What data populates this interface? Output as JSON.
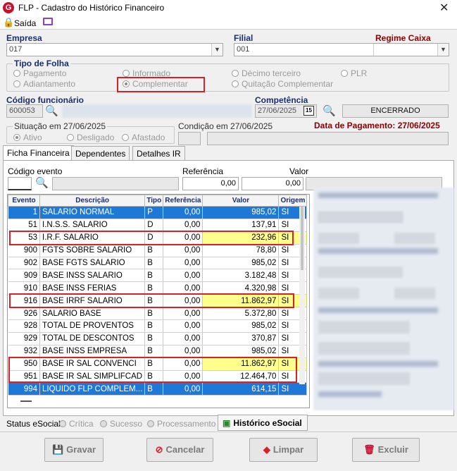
{
  "window": {
    "title": "FLP - Cadastro do Histórico Financeiro",
    "app_letter": "G"
  },
  "menu": {
    "exit_label": "Saída"
  },
  "empresa": {
    "label": "Empresa",
    "value": "017"
  },
  "filial": {
    "label": "Filial",
    "value": "001"
  },
  "regime": {
    "label": "Regime Caixa"
  },
  "tipo_folha": {
    "title": "Tipo de Folha",
    "options": [
      "Pagamento",
      "Informado",
      "Décimo terceiro",
      "PLR",
      "Adiantamento",
      "Complementar",
      "Quitação Complementar"
    ],
    "selected": "Complementar"
  },
  "codigo_funcionario": {
    "label": "Código funcionário",
    "value": "600053"
  },
  "competencia": {
    "label": "Competência",
    "value": "27/06/2025",
    "calendar_icon": "15",
    "status": "ENCERRADO"
  },
  "situacao": {
    "title": "Situação em 27/06/2025",
    "options": [
      "Ativo",
      "Desligado",
      "Afastado"
    ],
    "selected": "Ativo"
  },
  "condicao": {
    "title": "Condição em 27/06/2025"
  },
  "data_pagamento": "Data de Pagamento: 27/06/2025",
  "tabs": [
    "Ficha Financeira",
    "Dependentes",
    "Detalhes IR"
  ],
  "evento_form": {
    "codigo_label": "Código evento",
    "referencia_label": "Referência",
    "valor_label": "Valor",
    "referencia": "0,00",
    "valor": "0,00"
  },
  "grid": {
    "headers": [
      "Evento",
      "Descrição",
      "Tipo",
      "Referência",
      "Valor",
      "Origem"
    ],
    "rows": [
      {
        "evento": "1",
        "descricao": "SALARIO NORMAL",
        "tipo": "P",
        "ref": "0,00",
        "valor": "985,02",
        "origem": "SI",
        "selected": true
      },
      {
        "evento": "51",
        "descricao": "I.N.S.S. SALARIO",
        "tipo": "D",
        "ref": "0,00",
        "valor": "137,91",
        "origem": "SI"
      },
      {
        "evento": "53",
        "descricao": "I.R.F. SALARIO",
        "tipo": "D",
        "ref": "0,00",
        "valor": "232,96",
        "origem": "SI",
        "highlight": true
      },
      {
        "evento": "900",
        "descricao": "FGTS SOBRE SALARIO",
        "tipo": "B",
        "ref": "0,00",
        "valor": "78,80",
        "origem": "SI"
      },
      {
        "evento": "902",
        "descricao": "BASE FGTS SALARIO",
        "tipo": "B",
        "ref": "0,00",
        "valor": "985,02",
        "origem": "SI"
      },
      {
        "evento": "909",
        "descricao": "BASE INSS SALARIO",
        "tipo": "B",
        "ref": "0,00",
        "valor": "3.182,48",
        "origem": "SI"
      },
      {
        "evento": "910",
        "descricao": "BASE INSS FERIAS",
        "tipo": "B",
        "ref": "0,00",
        "valor": "4.320,98",
        "origem": "SI"
      },
      {
        "evento": "916",
        "descricao": "BASE IRRF SALARIO",
        "tipo": "B",
        "ref": "0,00",
        "valor": "11.862,97",
        "origem": "SI",
        "highlight": true
      },
      {
        "evento": "926",
        "descricao": "SALARIO BASE",
        "tipo": "B",
        "ref": "0,00",
        "valor": "5.372,80",
        "origem": "SI"
      },
      {
        "evento": "928",
        "descricao": "TOTAL DE PROVENTOS",
        "tipo": "B",
        "ref": "0,00",
        "valor": "985,02",
        "origem": "SI"
      },
      {
        "evento": "929",
        "descricao": "TOTAL DE DESCONTOS",
        "tipo": "B",
        "ref": "0,00",
        "valor": "370,87",
        "origem": "SI"
      },
      {
        "evento": "932",
        "descricao": "BASE INSS EMPRESA",
        "tipo": "B",
        "ref": "0,00",
        "valor": "985,02",
        "origem": "SI"
      },
      {
        "evento": "950",
        "descricao": "BASE IR SAL CONVENCI",
        "tipo": "B",
        "ref": "0,00",
        "valor": "11.862,97",
        "origem": "SI",
        "highlight": true
      },
      {
        "evento": "951",
        "descricao": "BASE IR SAL SIMPLIFCAD",
        "tipo": "B",
        "ref": "0,00",
        "valor": "12.464,70",
        "origem": "SI"
      },
      {
        "evento": "994",
        "descricao": "LIQUIDO FLP COMPLEM...",
        "tipo": "B",
        "ref": "0,00",
        "valor": "614,15",
        "origem": "SI",
        "selected": true
      }
    ]
  },
  "esocial": {
    "label": "Status eSocial:",
    "options": [
      "Crítica",
      "Sucesso",
      "Processamento"
    ],
    "history_button": "Histórico eSocial"
  },
  "buttons": {
    "gravar": "Gravar",
    "cancelar": "Cancelar",
    "limpar": "Limpar",
    "excluir": "Excluir"
  },
  "colors": {
    "accent_blue": "#1e78d8",
    "label_blue": "#1a2e6e",
    "highlight_red": "#d8202a",
    "highlight_yellow": "#ffff8c"
  }
}
